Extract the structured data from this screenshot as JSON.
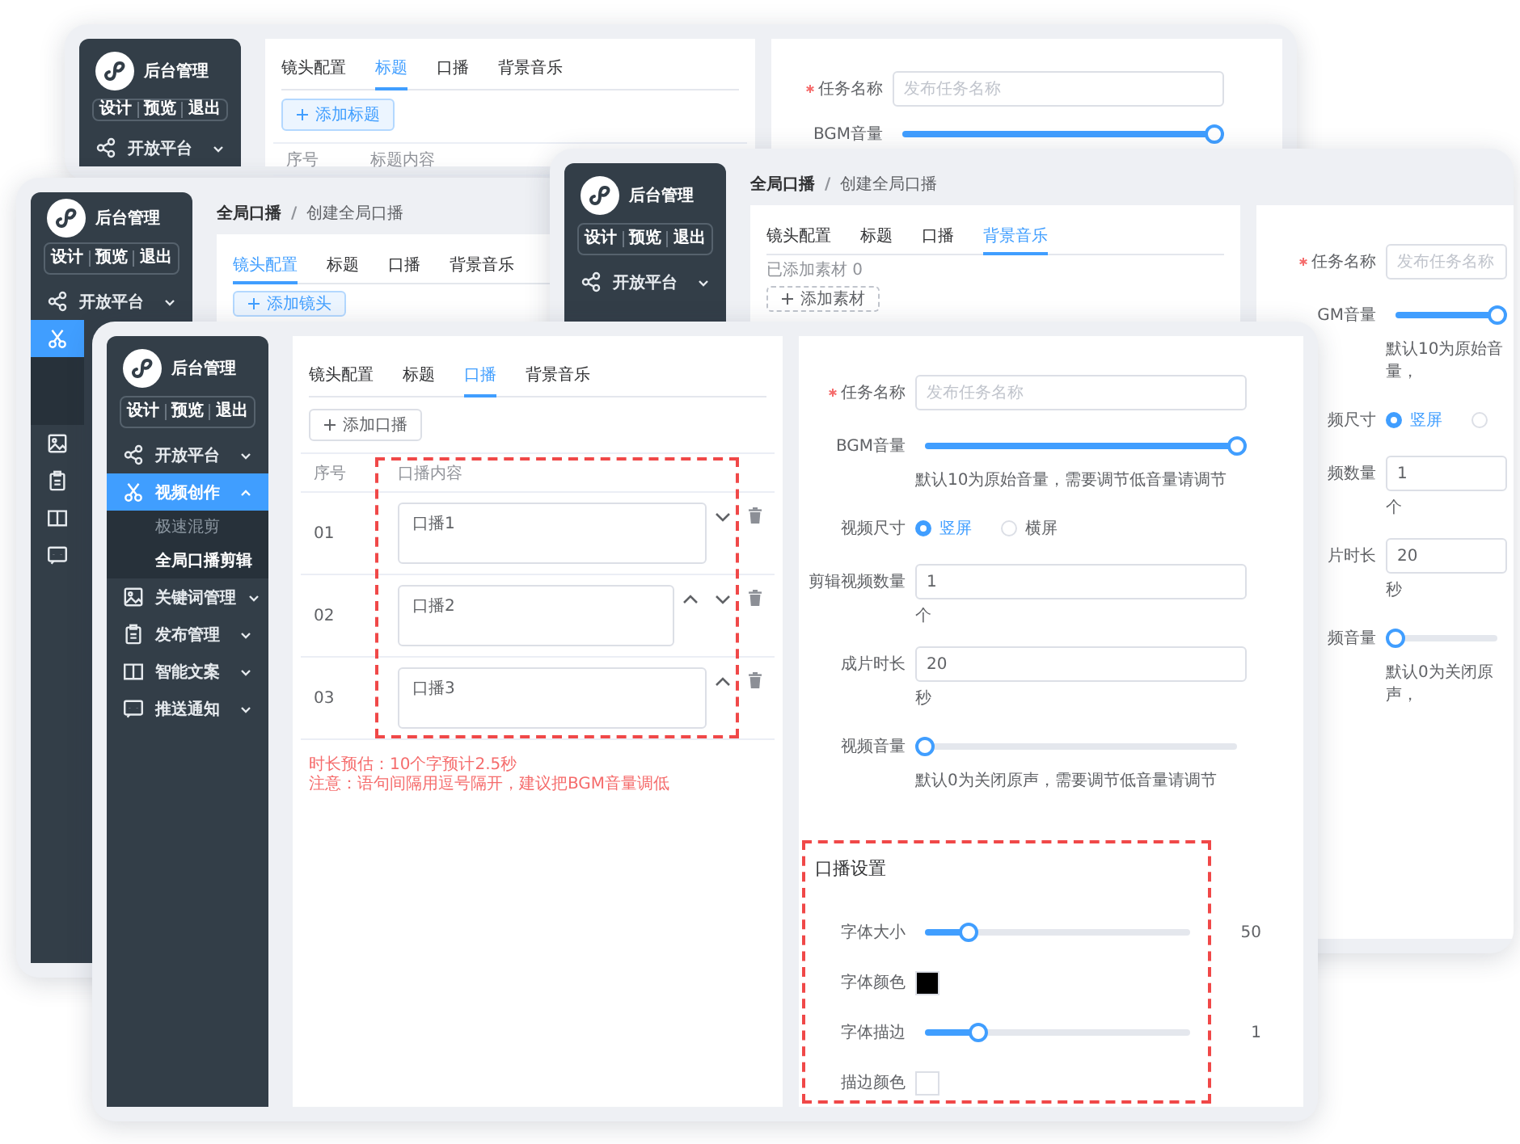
{
  "windows": [
    {
      "sidebar": {
        "title": "后台管理",
        "actions": [
          "设计",
          "预览",
          "退出"
        ],
        "menu": [
          {
            "label": "开放平台",
            "selected": false,
            "expanded": false
          }
        ]
      },
      "tabs_panel": {
        "tabs": [
          {
            "label": "镜头配置",
            "selected": false
          },
          {
            "label": "标题",
            "selected": true
          },
          {
            "label": "口播",
            "selected": false
          },
          {
            "label": "背景音乐",
            "selected": false
          }
        ],
        "add_button": {
          "kind": "light",
          "label": "添加标题"
        },
        "table": {
          "columns": [
            "序号",
            "标题内容"
          ]
        }
      },
      "form_panel": {
        "fields": [
          {
            "kind": "text",
            "label": "任务名称",
            "required": true,
            "placeholder": "发布任务名称"
          },
          {
            "kind": "slider",
            "label": "BGM音量",
            "level": 1
          }
        ]
      }
    },
    {
      "sidebar": {
        "title": "后台管理",
        "actions": [
          "设计",
          "预览",
          "退出"
        ],
        "menu": [
          {
            "label": "开放平台",
            "selected": false,
            "expanded": false
          },
          {
            "selected": true,
            "expanded": true
          },
          {
            "selected": false
          },
          {
            "selected": false
          },
          {
            "selected": false
          },
          {
            "selected": false
          }
        ]
      },
      "breadcrumb": {
        "items": [
          "全局口播",
          "创建全局口播"
        ],
        "separator": "/"
      },
      "tabs_panel": {
        "tabs": [
          {
            "label": "镜头配置",
            "selected": true
          },
          {
            "label": "标题",
            "selected": false
          },
          {
            "label": "口播",
            "selected": false
          },
          {
            "label": "背景音乐",
            "selected": false
          }
        ],
        "add_button": {
          "kind": "light",
          "label": "添加镜头"
        }
      }
    },
    {
      "sidebar": {
        "title": "后台管理",
        "actions": [
          "设计",
          "预览",
          "退出"
        ],
        "menu": [
          {
            "label": "开放平台",
            "selected": false,
            "expanded": false
          }
        ]
      },
      "breadcrumb": {
        "items": [
          "全局口播",
          "创建全局口播"
        ],
        "separator": "/"
      },
      "tabs_panel": {
        "tabs": [
          {
            "label": "镜头配置",
            "selected": false
          },
          {
            "label": "标题",
            "selected": false
          },
          {
            "label": "口播",
            "selected": false
          },
          {
            "label": "背景音乐",
            "selected": true
          }
        ],
        "material_count": "已添加素材 0",
        "add_button": {
          "kind": "dashed",
          "label": "添加素材"
        }
      },
      "form_panel": {
        "fields": [
          {
            "kind": "text",
            "label": "任务名称",
            "required": true,
            "placeholder": "发布任务名称"
          },
          {
            "kind": "slider",
            "label": "GM音量",
            "level": 1,
            "hint": "默认10为原始音量，"
          },
          {
            "kind": "radio",
            "label": "频尺寸",
            "options": [
              {
                "label": "竖屏",
                "selected": true
              },
              {
                "selected": false
              }
            ]
          },
          {
            "kind": "number",
            "label": "频数量",
            "value": "1",
            "unit": "个"
          },
          {
            "kind": "number",
            "label": "片时长",
            "value": "20",
            "unit": "秒"
          },
          {
            "kind": "slider",
            "label": "频音量",
            "level": 0,
            "hint": "默认0为关闭原声，"
          }
        ]
      }
    },
    {
      "sidebar": {
        "title": "后台管理",
        "actions": [
          "设计",
          "预览",
          "退出"
        ],
        "menu": [
          {
            "label": "开放平台",
            "selected": false,
            "expanded": false
          },
          {
            "label": "视频创作",
            "selected": true,
            "expanded": true,
            "children": [
              {
                "label": "极速混剪",
                "selected": false
              },
              {
                "label": "全局口播剪辑",
                "selected": true
              }
            ]
          },
          {
            "label": "关键词管理",
            "selected": false,
            "expanded": false
          },
          {
            "label": "发布管理",
            "selected": false,
            "expanded": false
          },
          {
            "label": "智能文案",
            "selected": false,
            "expanded": false
          },
          {
            "label": "推送通知",
            "selected": false,
            "expanded": false
          }
        ]
      },
      "tabs_panel": {
        "tabs": [
          {
            "label": "镜头配置",
            "selected": false
          },
          {
            "label": "标题",
            "selected": false
          },
          {
            "label": "口播",
            "selected": true
          },
          {
            "label": "背景音乐",
            "selected": false
          }
        ],
        "add_button": {
          "kind": "outline",
          "label": "添加口播"
        },
        "table": {
          "columns": [
            "序号",
            "口播内容"
          ],
          "highlighted": true,
          "rows": [
            {
              "index": "01",
              "text": "口播1",
              "can_move_up": false,
              "can_move_down": true
            },
            {
              "index": "02",
              "text": "口播2",
              "can_move_up": true,
              "can_move_down": true
            },
            {
              "index": "03",
              "text": "口播3",
              "can_move_up": true,
              "can_move_down": false
            }
          ]
        },
        "notes": [
          "时长预估：10个字预计2.5秒",
          "注意：语句间隔用逗号隔开，建议把BGM音量调低"
        ]
      },
      "form_panel": {
        "fields": [
          {
            "kind": "text",
            "label": "任务名称",
            "required": true,
            "placeholder": "发布任务名称"
          },
          {
            "kind": "slider",
            "label": "BGM音量",
            "level": 1,
            "hint": "默认10为原始音量，需要调节低音量请调节"
          },
          {
            "kind": "radio",
            "label": "视频尺寸",
            "options": [
              {
                "label": "竖屏",
                "selected": true
              },
              {
                "label": "横屏",
                "selected": false
              }
            ]
          },
          {
            "kind": "number",
            "label": "剪辑视频数量",
            "value": "1",
            "unit": "个"
          },
          {
            "kind": "number",
            "label": "成片时长",
            "value": "20",
            "unit": "秒"
          },
          {
            "kind": "slider",
            "label": "视频音量",
            "level": 0,
            "hint": "默认0为关闭原声，需要调节低音量请调节"
          }
        ],
        "section": {
          "title": "口播设置",
          "highlighted": true,
          "fields": [
            {
              "kind": "slider",
              "label": "字体大小",
              "level": 0.165,
              "reading": "50"
            },
            {
              "kind": "color",
              "label": "字体颜色",
              "color": "#000000"
            },
            {
              "kind": "slider",
              "label": "字体描边",
              "level": 0.2,
              "reading": "1"
            },
            {
              "kind": "color",
              "label": "描边颜色",
              "color": "#ffffff"
            }
          ]
        }
      }
    }
  ]
}
